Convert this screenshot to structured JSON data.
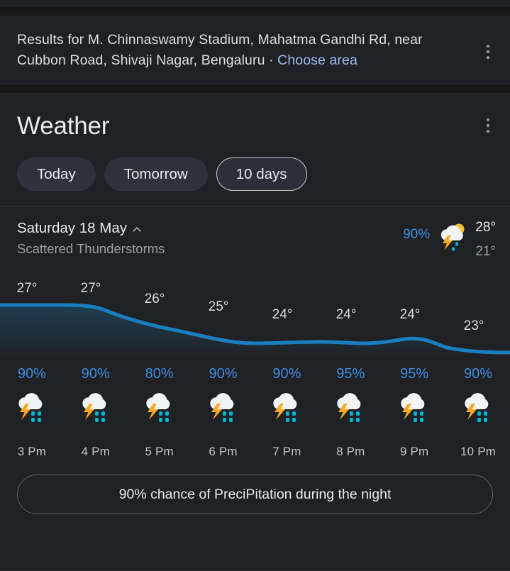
{
  "results_header": {
    "prefix": "Results for ",
    "location": "M. Chinnaswamy Stadium, Mahatma Gandhi Rd, near Cubbon Road, Shivaji Nagar, Bengaluru",
    "separator": " · ",
    "choose_area_label": "Choose area",
    "menu_icon": "more-vert-icon"
  },
  "weather": {
    "title": "Weather",
    "menu_icon": "more-vert-icon",
    "tabs": [
      {
        "label": "Today",
        "selected": false
      },
      {
        "label": "Tomorrow",
        "selected": false
      },
      {
        "label": "10 days",
        "selected": true
      }
    ],
    "day": {
      "name": "Saturday 18 May",
      "expand_icon": "chevron-up-icon",
      "condition": "Scattered Thunderstorms",
      "precipitation": "90%",
      "icon": "thunderstorm-sun-rain-icon",
      "high": "28°",
      "low": "21°"
    },
    "night_banner": {
      "label": "90% chance of PreciPitation during the night"
    }
  },
  "chart_data": {
    "type": "line",
    "title": "Hourly temperature",
    "x": [
      "3 Pm",
      "4 Pm",
      "5 Pm",
      "6 Pm",
      "7 Pm",
      "8 Pm",
      "9 Pm",
      "10 Pm"
    ],
    "values": [
      27,
      27,
      26,
      25,
      24,
      24,
      24,
      23
    ],
    "tick_labels": [
      "27°",
      "27°",
      "26°",
      "25°",
      "24°",
      "24°",
      "24°",
      "23°"
    ],
    "unit": "°",
    "ylim": [
      22,
      28
    ],
    "grid": false,
    "legend": "none",
    "line_color": "#1a7fc1",
    "fill": "gradient",
    "xlabel": "",
    "ylabel": ""
  },
  "hourly": [
    {
      "precipitation": "90%",
      "icon": "thunderstorm-rain-icon",
      "time": "3 Pm"
    },
    {
      "precipitation": "90%",
      "icon": "thunderstorm-rain-icon",
      "time": "4 Pm"
    },
    {
      "precipitation": "80%",
      "icon": "thunderstorm-rain-icon",
      "time": "5 Pm"
    },
    {
      "precipitation": "90%",
      "icon": "thunderstorm-rain-icon",
      "time": "6 Pm"
    },
    {
      "precipitation": "90%",
      "icon": "thunderstorm-rain-icon",
      "time": "7 Pm"
    },
    {
      "precipitation": "95%",
      "icon": "thunderstorm-rain-icon",
      "time": "8 Pm"
    },
    {
      "precipitation": "95%",
      "icon": "thunderstorm-rain-icon",
      "time": "9 Pm"
    },
    {
      "precipitation": "90%",
      "icon": "thunderstorm-rain-icon",
      "time": "10 Pm"
    }
  ],
  "colors": {
    "background": "#202124",
    "accent_blue": "#3d8ee0",
    "link_blue": "#9fbbf7",
    "chart_line": "#1a7fc1",
    "cloud": "#f1f3f4",
    "bolt": "#f9a825",
    "raindrop": "#00b8d4",
    "sun": "#fbc02d"
  }
}
